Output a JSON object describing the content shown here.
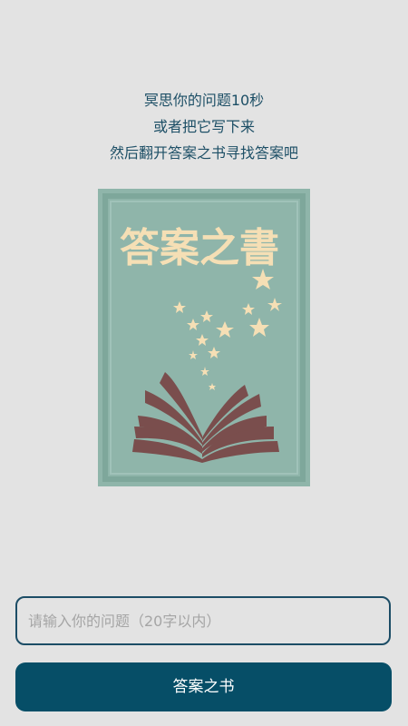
{
  "intro": {
    "line1": "冥思你的问题10秒",
    "line2": "或者把它写下来",
    "line3": "然后翻开答案之书寻找答案吧"
  },
  "cover": {
    "title": "答案之書",
    "background_color": "#8fb5aa",
    "title_color": "#f5dfb5",
    "book_color": "#7a4e4d",
    "icons": [
      "star-icon",
      "open-book-icon"
    ]
  },
  "question_input": {
    "placeholder": "请输入你的问题（20字以内）",
    "value": ""
  },
  "submit_button": {
    "label": "答案之书"
  },
  "colors": {
    "background": "#e3e3e3",
    "accent": "#064e67",
    "text": "#1d4f66"
  }
}
